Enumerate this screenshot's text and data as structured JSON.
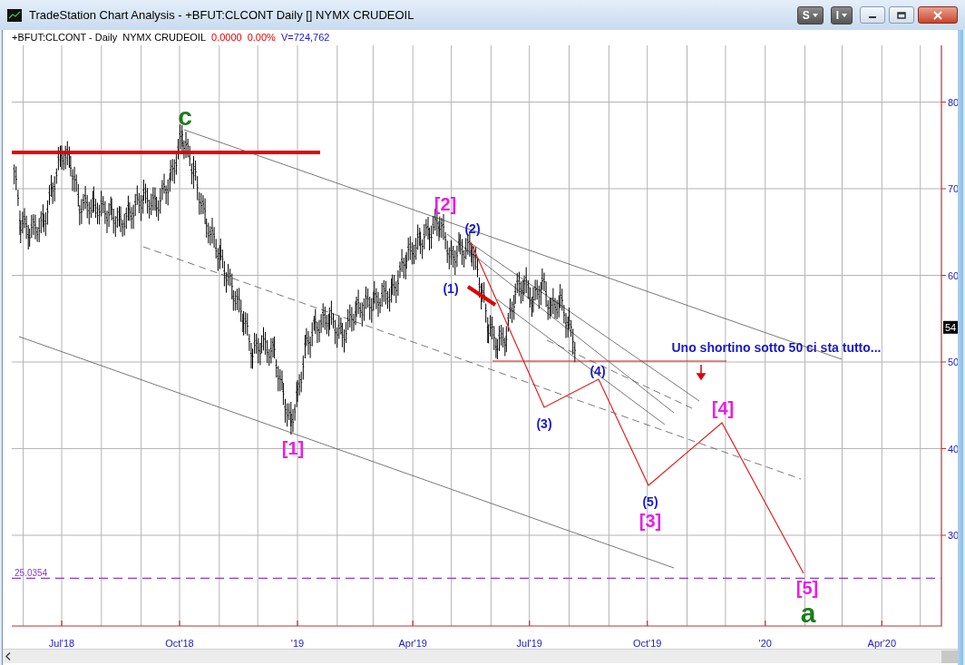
{
  "window": {
    "title": "TradeStation Chart Analysis - +BFUT:CLCONT Daily [] NYMX CRUDEOIL",
    "buttons": [
      {
        "label": "S",
        "kind": "menu"
      },
      {
        "label": "I",
        "kind": "menu"
      },
      {
        "kind": "minimize"
      },
      {
        "kind": "maximize"
      },
      {
        "kind": "close"
      }
    ]
  },
  "chart": {
    "header": {
      "symbol": "+BFUT:CLCONT - Daily  NYMX CRUDEOIL",
      "change": "0.0000",
      "change_percent": "0.00%",
      "volume": "V=724,762"
    },
    "price_axis": [
      "80",
      "70",
      "60",
      "50",
      "40",
      "30"
    ],
    "date_axis": [
      "Jul'18",
      "Oct'18",
      "'19",
      "Apr'19",
      "Jul'19",
      "Oct'19",
      "'20",
      "Apr'20"
    ],
    "last_price": "54",
    "level_label": "25.0354",
    "labels": [
      {
        "text": "c",
        "color": "#1b7d1b"
      },
      {
        "text": "[1]",
        "color": "#e81ee8"
      },
      {
        "text": "[2]",
        "color": "#e81ee8"
      },
      {
        "text": "(2)",
        "color": "#1818c8"
      },
      {
        "text": "(1)",
        "color": "#1818c8"
      },
      {
        "text": "(3)",
        "color": "#1818c8"
      },
      {
        "text": "(4)",
        "color": "#1818c8"
      },
      {
        "text": "[4]",
        "color": "#e81ee8"
      },
      {
        "text": "(5)",
        "color": "#1818c8"
      },
      {
        "text": "[3]",
        "color": "#e81ee8"
      },
      {
        "text": "[5]",
        "color": "#e81ee8"
      },
      {
        "text": "a",
        "color": "#1b7d1b"
      }
    ],
    "comment": "Uno shortino sotto 50 ci sta tutto..."
  }
}
